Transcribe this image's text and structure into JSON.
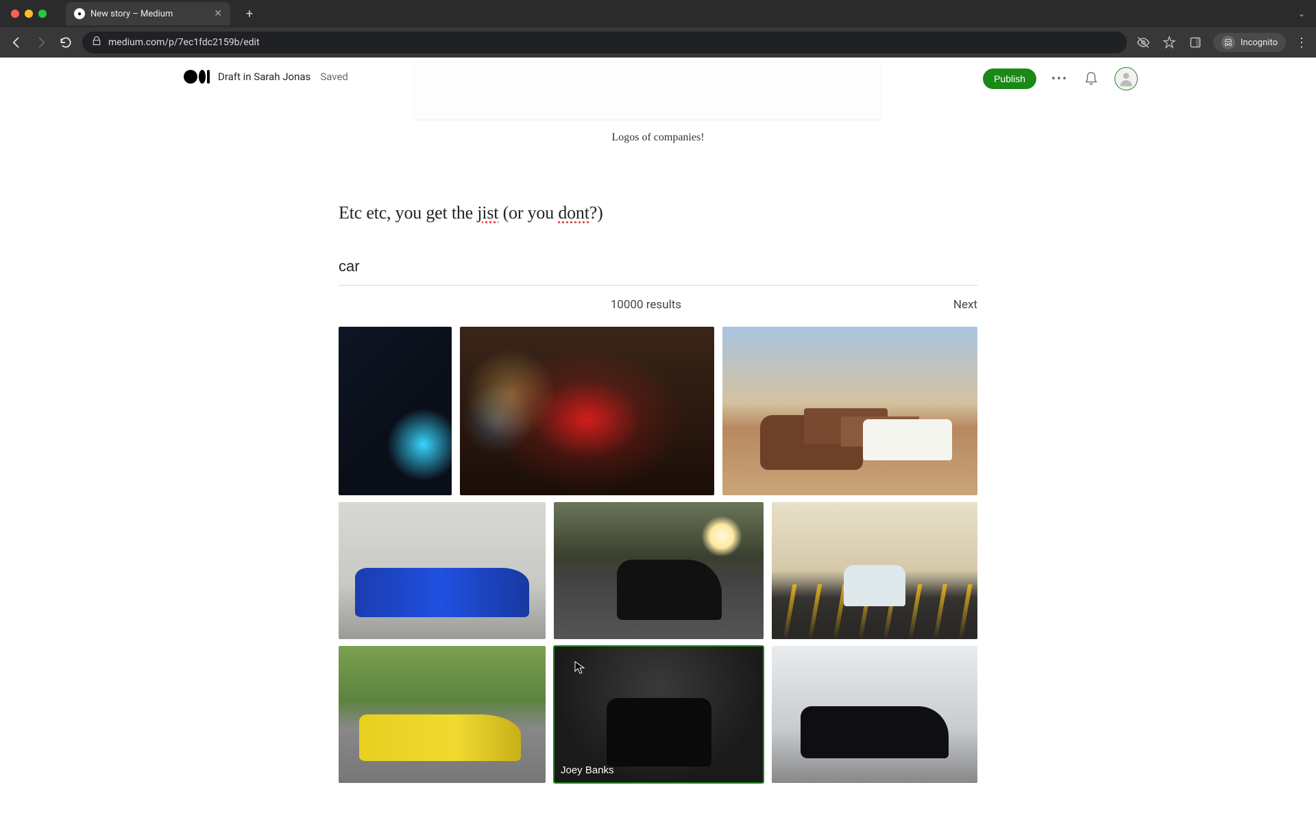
{
  "browser": {
    "tab_title": "New story – Medium",
    "url": "medium.com/p/7ec1fdc2159b/edit",
    "incognito_label": "Incognito"
  },
  "header": {
    "draft_label": "Draft in Sarah Jonas",
    "saved_label": "Saved",
    "publish_label": "Publish"
  },
  "editor": {
    "caption": "Logos of companies!",
    "body_prefix": "Etc etc, you get the ",
    "body_spell1": "jist",
    "body_mid": " (or you ",
    "body_spell2": "dont",
    "body_suffix": "?)"
  },
  "search": {
    "query": "car",
    "results_count": "10000 results",
    "next_label": "Next"
  },
  "gallery": {
    "hover_credit": "Joey Banks"
  }
}
